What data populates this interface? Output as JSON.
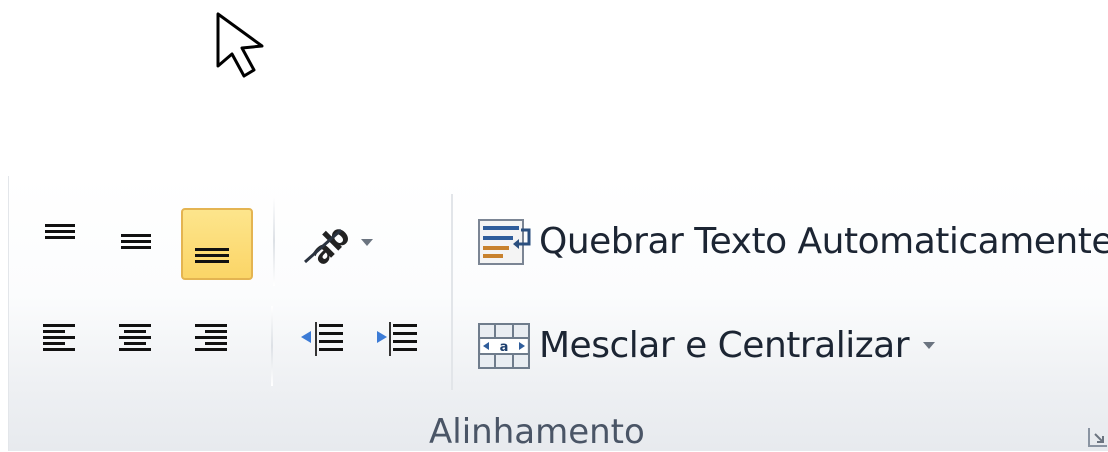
{
  "ribbon_group": {
    "label": "Alinhamento",
    "wrap_text_label": "Quebrar Texto Automaticamente",
    "merge_center_label": "Mesclar e Centralizar",
    "active_button": "align-bottom",
    "accent_color": "#fbd567"
  },
  "icons": {
    "cursor": "mouse-pointer-icon",
    "align_top": "align-top-icon",
    "align_middle": "align-middle-icon",
    "align_bottom": "align-bottom-icon",
    "orientation": "text-orientation-icon",
    "align_left": "align-left-icon",
    "align_center": "align-center-icon",
    "align_right": "align-right-icon",
    "decrease_indent": "decrease-indent-icon",
    "increase_indent": "increase-indent-icon",
    "wrap_text": "wrap-text-icon",
    "merge_center": "merge-center-icon",
    "launcher": "dialog-launcher-icon"
  }
}
